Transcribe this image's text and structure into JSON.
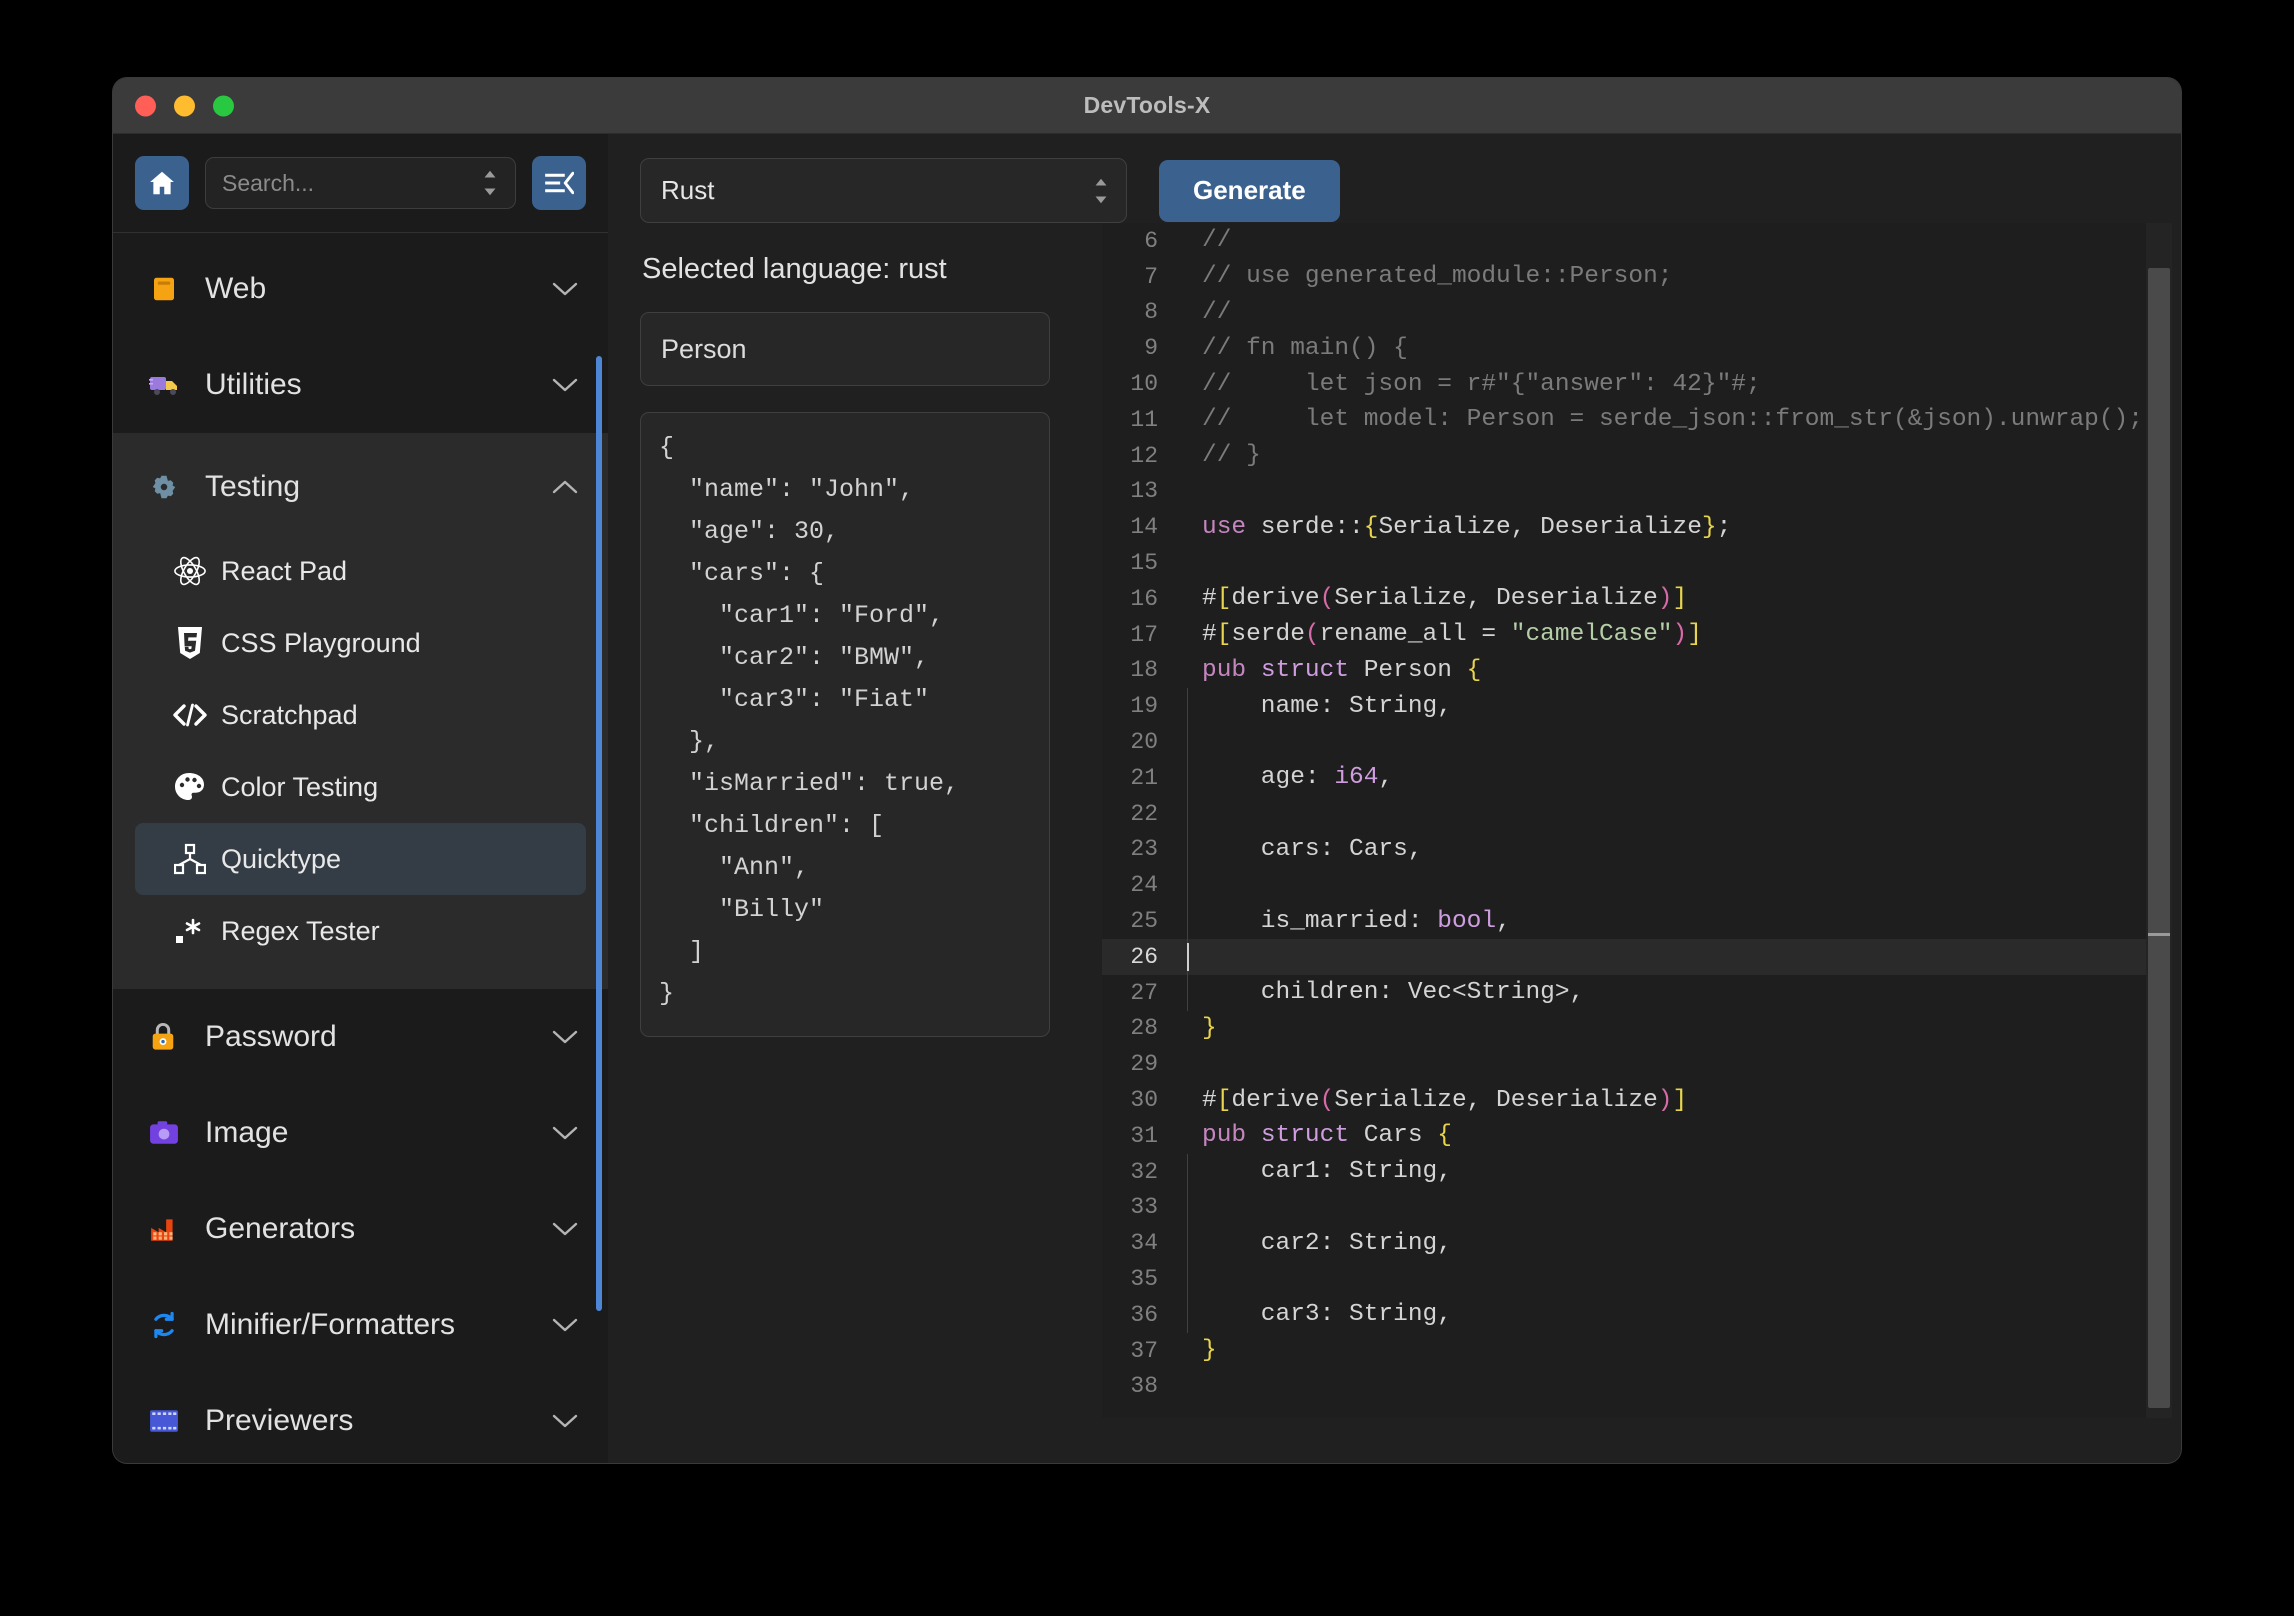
{
  "window": {
    "title": "DevTools-X",
    "traffic_lights": [
      "close-red",
      "minimize-yellow",
      "maximize-green"
    ]
  },
  "sidebar": {
    "home_icon": "home-icon",
    "collapse_icon": "menu-collapse-icon",
    "search": {
      "placeholder": "Search...",
      "value": ""
    },
    "groups": [
      {
        "label": "Web",
        "icon": "orange-card-icon",
        "expanded": false,
        "chevron": "chevron-down-icon"
      },
      {
        "label": "Utilities",
        "icon": "delivery-truck-icon",
        "expanded": false,
        "chevron": "chevron-down-icon"
      },
      {
        "label": "Testing",
        "icon": "gear-icon",
        "expanded": true,
        "chevron": "chevron-up-icon",
        "items": [
          {
            "label": "React Pad",
            "icon": "react-atom-icon",
            "active": false
          },
          {
            "label": "CSS Playground",
            "icon": "css3-icon",
            "active": false
          },
          {
            "label": "Scratchpad",
            "icon": "code-brackets-icon",
            "active": false
          },
          {
            "label": "Color Testing",
            "icon": "palette-icon",
            "active": false
          },
          {
            "label": "Quicktype",
            "icon": "node-graph-icon",
            "active": true
          },
          {
            "label": "Regex Tester",
            "icon": "regex-asterisk-icon",
            "active": false
          }
        ]
      },
      {
        "label": "Password",
        "icon": "padlock-icon",
        "expanded": false,
        "chevron": "chevron-down-icon"
      },
      {
        "label": "Image",
        "icon": "camera-icon",
        "expanded": false,
        "chevron": "chevron-down-icon"
      },
      {
        "label": "Generators",
        "icon": "factory-icon",
        "expanded": false,
        "chevron": "chevron-down-icon"
      },
      {
        "label": "Minifier/Formatters",
        "icon": "refresh-cycle-icon",
        "expanded": false,
        "chevron": "chevron-down-icon"
      },
      {
        "label": "Previewers",
        "icon": "film-strip-icon",
        "expanded": false,
        "chevron": "chevron-down-icon"
      }
    ]
  },
  "main": {
    "language_select": {
      "value": "Rust",
      "icon": "stepper-updown-icon"
    },
    "generate_button": "Generate",
    "selected_language_text": "Selected language: rust",
    "type_name_input": {
      "value": "Person",
      "placeholder": ""
    },
    "json_input": "{\n  \"name\": \"John\",\n  \"age\": 30,\n  \"cars\": {\n    \"car1\": \"Ford\",\n    \"car2\": \"BMW\",\n    \"car3\": \"Fiat\"\n  },\n  \"isMarried\": true,\n  \"children\": [\n    \"Ann\",\n    \"Billy\"\n  ]\n}"
  },
  "editor": {
    "active_line": 26,
    "first_visible_line": 6,
    "last_visible_line": 38,
    "lines": [
      {
        "n": 6,
        "tokens": [
          {
            "t": "//",
            "c": "cm"
          }
        ]
      },
      {
        "n": 7,
        "tokens": [
          {
            "t": "// use generated_module::Person;",
            "c": "cm"
          }
        ]
      },
      {
        "n": 8,
        "tokens": [
          {
            "t": "//",
            "c": "cm"
          }
        ]
      },
      {
        "n": 9,
        "tokens": [
          {
            "t": "// fn main() {",
            "c": "cm"
          }
        ]
      },
      {
        "n": 10,
        "tokens": [
          {
            "t": "//     let json = r#\"{\"answer\": 42}\"#;",
            "c": "cm"
          }
        ]
      },
      {
        "n": 11,
        "tokens": [
          {
            "t": "//     let model: Person = serde_json::from_str(&json).unwrap();",
            "c": "cm"
          }
        ]
      },
      {
        "n": 12,
        "tokens": [
          {
            "t": "// }",
            "c": "cm"
          }
        ]
      },
      {
        "n": 13,
        "tokens": []
      },
      {
        "n": 14,
        "tokens": [
          {
            "t": "use",
            "c": "kw"
          },
          {
            "t": " serde::",
            "c": "plain"
          },
          {
            "t": "{",
            "c": "brk"
          },
          {
            "t": "Serialize, Deserialize",
            "c": "plain"
          },
          {
            "t": "}",
            "c": "brk"
          },
          {
            "t": ";",
            "c": "plain"
          }
        ]
      },
      {
        "n": 15,
        "tokens": []
      },
      {
        "n": 16,
        "tokens": [
          {
            "t": "#",
            "c": "plain"
          },
          {
            "t": "[",
            "c": "brk"
          },
          {
            "t": "derive",
            "c": "plain"
          },
          {
            "t": "(",
            "c": "pink"
          },
          {
            "t": "Serialize, Deserialize",
            "c": "plain"
          },
          {
            "t": ")",
            "c": "pink"
          },
          {
            "t": "]",
            "c": "brk"
          }
        ]
      },
      {
        "n": 17,
        "tokens": [
          {
            "t": "#",
            "c": "plain"
          },
          {
            "t": "[",
            "c": "brk"
          },
          {
            "t": "serde",
            "c": "plain"
          },
          {
            "t": "(",
            "c": "pink"
          },
          {
            "t": "rename_all = ",
            "c": "plain"
          },
          {
            "t": "\"camelCase\"",
            "c": "str"
          },
          {
            "t": ")",
            "c": "pink"
          },
          {
            "t": "]",
            "c": "brk"
          }
        ]
      },
      {
        "n": 18,
        "tokens": [
          {
            "t": "pub",
            "c": "kw"
          },
          {
            "t": " ",
            "c": "plain"
          },
          {
            "t": "struct",
            "c": "ty"
          },
          {
            "t": " Person ",
            "c": "plain"
          },
          {
            "t": "{",
            "c": "brk"
          }
        ]
      },
      {
        "n": 19,
        "tokens": [
          {
            "t": "    name: String,",
            "c": "plain"
          }
        ]
      },
      {
        "n": 20,
        "tokens": []
      },
      {
        "n": 21,
        "tokens": [
          {
            "t": "    age: ",
            "c": "plain"
          },
          {
            "t": "i64",
            "c": "ty"
          },
          {
            "t": ",",
            "c": "plain"
          }
        ]
      },
      {
        "n": 22,
        "tokens": []
      },
      {
        "n": 23,
        "tokens": [
          {
            "t": "    cars: Cars,",
            "c": "plain"
          }
        ]
      },
      {
        "n": 24,
        "tokens": []
      },
      {
        "n": 25,
        "tokens": [
          {
            "t": "    is_married: ",
            "c": "plain"
          },
          {
            "t": "bool",
            "c": "ty"
          },
          {
            "t": ",",
            "c": "plain"
          }
        ]
      },
      {
        "n": 26,
        "tokens": []
      },
      {
        "n": 27,
        "tokens": [
          {
            "t": "    children: Vec<String>,",
            "c": "plain"
          }
        ]
      },
      {
        "n": 28,
        "tokens": [
          {
            "t": "}",
            "c": "brk"
          }
        ]
      },
      {
        "n": 29,
        "tokens": []
      },
      {
        "n": 30,
        "tokens": [
          {
            "t": "#",
            "c": "plain"
          },
          {
            "t": "[",
            "c": "brk"
          },
          {
            "t": "derive",
            "c": "plain"
          },
          {
            "t": "(",
            "c": "pink"
          },
          {
            "t": "Serialize, Deserialize",
            "c": "plain"
          },
          {
            "t": ")",
            "c": "pink"
          },
          {
            "t": "]",
            "c": "brk"
          }
        ]
      },
      {
        "n": 31,
        "tokens": [
          {
            "t": "pub",
            "c": "kw"
          },
          {
            "t": " ",
            "c": "plain"
          },
          {
            "t": "struct",
            "c": "ty"
          },
          {
            "t": " Cars ",
            "c": "plain"
          },
          {
            "t": "{",
            "c": "brk"
          }
        ]
      },
      {
        "n": 32,
        "tokens": [
          {
            "t": "    car1: String,",
            "c": "plain"
          }
        ]
      },
      {
        "n": 33,
        "tokens": []
      },
      {
        "n": 34,
        "tokens": [
          {
            "t": "    car2: String,",
            "c": "plain"
          }
        ]
      },
      {
        "n": 35,
        "tokens": []
      },
      {
        "n": 36,
        "tokens": [
          {
            "t": "    car3: String,",
            "c": "plain"
          }
        ]
      },
      {
        "n": 37,
        "tokens": [
          {
            "t": "}",
            "c": "brk"
          }
        ]
      },
      {
        "n": 38,
        "tokens": []
      }
    ]
  },
  "colors": {
    "accent_blue": "#3b628f",
    "scrollbar_blue": "#4e86d6",
    "window_bg": "#202020",
    "sidebar_bg": "#1b1b1b",
    "subpanel_bg": "#2b2b2b",
    "active_item_bg": "#343c46",
    "editor_bg": "#1e1e1e",
    "titlebar_bg": "#3b3b3b"
  }
}
